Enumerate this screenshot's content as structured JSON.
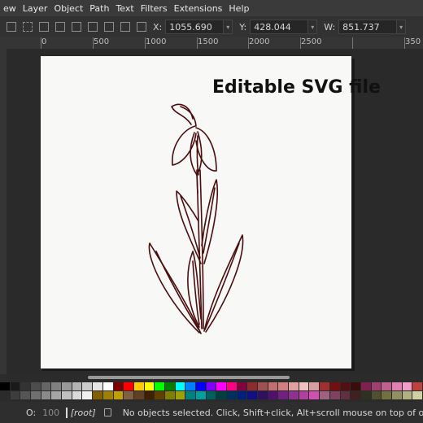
{
  "menu": [
    "ew",
    "Layer",
    "Object",
    "Path",
    "Text",
    "Filters",
    "Extensions",
    "Help"
  ],
  "toolbar": {
    "x_label": "X:",
    "x_value": "1055.690",
    "y_label": "Y:",
    "y_value": "428.044",
    "w_label": "W:",
    "w_value": "851.737"
  },
  "ruler": [
    "0",
    "500",
    "1000",
    "1500",
    "2000",
    "2500",
    "350"
  ],
  "canvas": {
    "watermark": "Editable SVG file"
  },
  "palette": {
    "row1": [
      "#000000",
      "#1a1a1a",
      "#333333",
      "#4d4d4d",
      "#666666",
      "#808080",
      "#999999",
      "#b3b3b3",
      "#cccccc",
      "#e6e6e6",
      "#ffffff",
      "#800000",
      "#ff0000",
      "#ffcc00",
      "#ffff00",
      "#00ff00",
      "#008000",
      "#00ffff",
      "#0080ff",
      "#0000ff",
      "#8000ff",
      "#ff00ff",
      "#ff0080",
      "#800040",
      "#8c2d2d",
      "#a05050",
      "#c07070",
      "#d08080",
      "#e0a0a0",
      "#f0c0c0",
      "#d4a0a0",
      "#a03030",
      "#701010",
      "#501010",
      "#3a0c0c",
      "#802050",
      "#a04070",
      "#c06090",
      "#e080b0",
      "#f0a0c8",
      "#c04040"
    ],
    "row2": [
      "#2b2b2b",
      "#3d3d3d",
      "#555555",
      "#707070",
      "#8a8a8a",
      "#a5a5a5",
      "#c0c0c0",
      "#dadada",
      "#f0f0f0",
      "#806000",
      "#a08000",
      "#c0a000",
      "#806040",
      "#604020",
      "#402000",
      "#604000",
      "#808000",
      "#a0a000",
      "#008080",
      "#00a0a0",
      "#006060",
      "#004040",
      "#003060",
      "#002080",
      "#101080",
      "#301060",
      "#501070",
      "#702080",
      "#903090",
      "#b040a0",
      "#d050b0",
      "#a06080",
      "#804060",
      "#603040",
      "#402020",
      "#303020",
      "#505030",
      "#707040",
      "#909060",
      "#b0b080",
      "#d0d0a0"
    ]
  },
  "status": {
    "opacity_label": "O:",
    "opacity_value": "100",
    "layer": "[root]",
    "message": "No objects selected. Click, Shift+click, Alt+scroll mouse on top of objects, o"
  },
  "colors": {
    "stroke": "#4a0d0d",
    "page": "#f8f8f6"
  }
}
